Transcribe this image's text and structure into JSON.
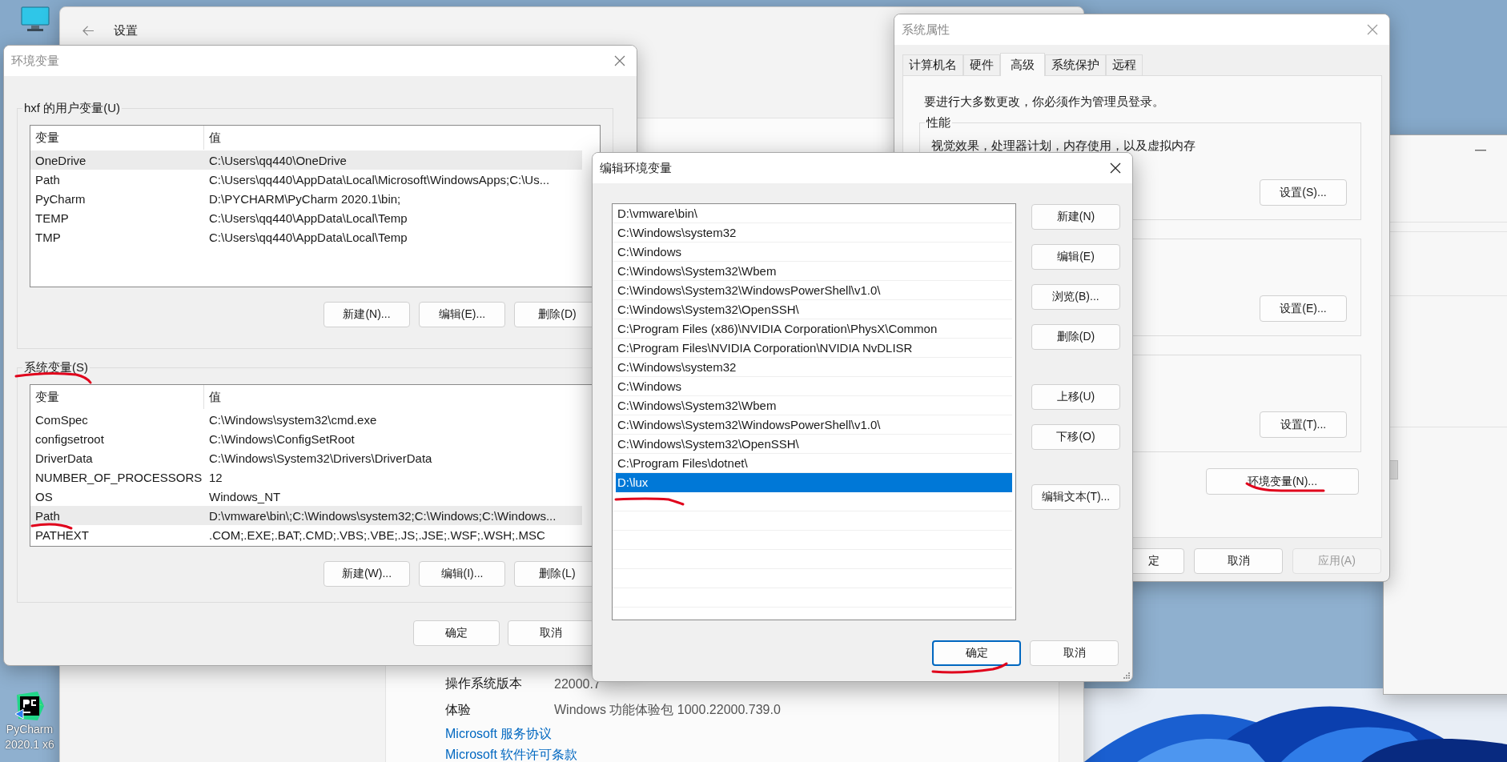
{
  "desktop": {
    "icons": [
      {
        "kind": "monitor"
      },
      {
        "kind": "pycharm",
        "lines": [
          "PyCharm",
          "2020.1 x6"
        ]
      }
    ]
  },
  "settings": {
    "title": "设置",
    "info": [
      {
        "label": "操作系统版本",
        "value": "22000.7"
      },
      {
        "label": "体验",
        "value": "Windows 功能体验包 1000.22000.739.0"
      }
    ],
    "links": [
      "Microsoft 服务协议",
      "Microsoft 软件许可条款"
    ]
  },
  "env_dialog": {
    "title": "环境变量",
    "groups": [
      {
        "label": "hxf 的用户变量(U)",
        "columns": [
          "变量",
          "值"
        ],
        "rows": [
          {
            "name": "OneDrive",
            "value": "C:\\Users\\qq440\\OneDrive",
            "selected": true
          },
          {
            "name": "Path",
            "value": "C:\\Users\\qq440\\AppData\\Local\\Microsoft\\WindowsApps;C:\\Us...",
            "selected": false
          },
          {
            "name": "PyCharm",
            "value": "D:\\PYCHARM\\PyCharm 2020.1\\bin;",
            "selected": false
          },
          {
            "name": "TEMP",
            "value": "C:\\Users\\qq440\\AppData\\Local\\Temp",
            "selected": false
          },
          {
            "name": "TMP",
            "value": "C:\\Users\\qq440\\AppData\\Local\\Temp",
            "selected": false
          }
        ],
        "buttons": [
          "新建(N)...",
          "编辑(E)...",
          "删除(D)"
        ]
      },
      {
        "label": "系统变量(S)",
        "columns": [
          "变量",
          "值"
        ],
        "rows": [
          {
            "name": "ComSpec",
            "value": "C:\\Windows\\system32\\cmd.exe",
            "selected": false
          },
          {
            "name": "configsetroot",
            "value": "C:\\Windows\\ConfigSetRoot",
            "selected": false
          },
          {
            "name": "DriverData",
            "value": "C:\\Windows\\System32\\Drivers\\DriverData",
            "selected": false
          },
          {
            "name": "NUMBER_OF_PROCESSORS",
            "value": "12",
            "selected": false
          },
          {
            "name": "OS",
            "value": "Windows_NT",
            "selected": false
          },
          {
            "name": "Path",
            "value": "D:\\vmware\\bin\\;C:\\Windows\\system32;C:\\Windows;C:\\Windows...",
            "selected": true
          },
          {
            "name": "PATHEXT",
            "value": ".COM;.EXE;.BAT;.CMD;.VBS;.VBE;.JS;.JSE;.WSF;.WSH;.MSC",
            "selected": false
          }
        ],
        "buttons": [
          "新建(W)...",
          "编辑(I)...",
          "删除(L)"
        ]
      }
    ],
    "buttons": [
      "确定",
      "取消"
    ]
  },
  "system_properties": {
    "title": "系统属性",
    "tabs": [
      {
        "label": "计算机名",
        "selected": false
      },
      {
        "label": "硬件",
        "selected": false
      },
      {
        "label": "高级",
        "selected": true
      },
      {
        "label": "系统保护",
        "selected": false
      },
      {
        "label": "远程",
        "selected": false
      }
    ],
    "notice": "要进行大多数更改，你必须作为管理员登录。",
    "groups": [
      {
        "label": "性能",
        "description": "视觉效果，处理器计划，内存使用，以及虚拟内存",
        "button": "设置(S)..."
      },
      {
        "button": "设置(E)..."
      },
      {
        "button": "设置(T)..."
      }
    ],
    "env_button": "环境变量(N)...",
    "buttons": [
      {
        "label": "定",
        "disabled": false
      },
      {
        "label": "取消",
        "disabled": false
      },
      {
        "label": "应用(A)",
        "disabled": true
      }
    ]
  },
  "edit_dialog": {
    "title": "编辑环境变量",
    "entries": [
      {
        "text": "D:\\vmware\\bin\\",
        "selected": false
      },
      {
        "text": "C:\\Windows\\system32",
        "selected": false
      },
      {
        "text": "C:\\Windows",
        "selected": false
      },
      {
        "text": "C:\\Windows\\System32\\Wbem",
        "selected": false
      },
      {
        "text": "C:\\Windows\\System32\\WindowsPowerShell\\v1.0\\",
        "selected": false
      },
      {
        "text": "C:\\Windows\\System32\\OpenSSH\\",
        "selected": false
      },
      {
        "text": "C:\\Program Files (x86)\\NVIDIA Corporation\\PhysX\\Common",
        "selected": false
      },
      {
        "text": "C:\\Program Files\\NVIDIA Corporation\\NVIDIA NvDLISR",
        "selected": false
      },
      {
        "text": "C:\\Windows\\system32",
        "selected": false
      },
      {
        "text": "C:\\Windows",
        "selected": false
      },
      {
        "text": "C:\\Windows\\System32\\Wbem",
        "selected": false
      },
      {
        "text": "C:\\Windows\\System32\\WindowsPowerShell\\v1.0\\",
        "selected": false
      },
      {
        "text": "C:\\Windows\\System32\\OpenSSH\\",
        "selected": false
      },
      {
        "text": "C:\\Program Files\\dotnet\\",
        "selected": false
      },
      {
        "text": "D:\\lux",
        "selected": true
      }
    ],
    "side_buttons": [
      [
        "新建(N)",
        "编辑(E)",
        "浏览(B)...",
        "删除(D)"
      ],
      [
        "上移(U)",
        "下移(O)"
      ],
      [
        "编辑文本(T)..."
      ]
    ],
    "buttons": [
      {
        "label": "确定",
        "focused": true
      },
      {
        "label": "取消",
        "focused": false
      }
    ]
  }
}
